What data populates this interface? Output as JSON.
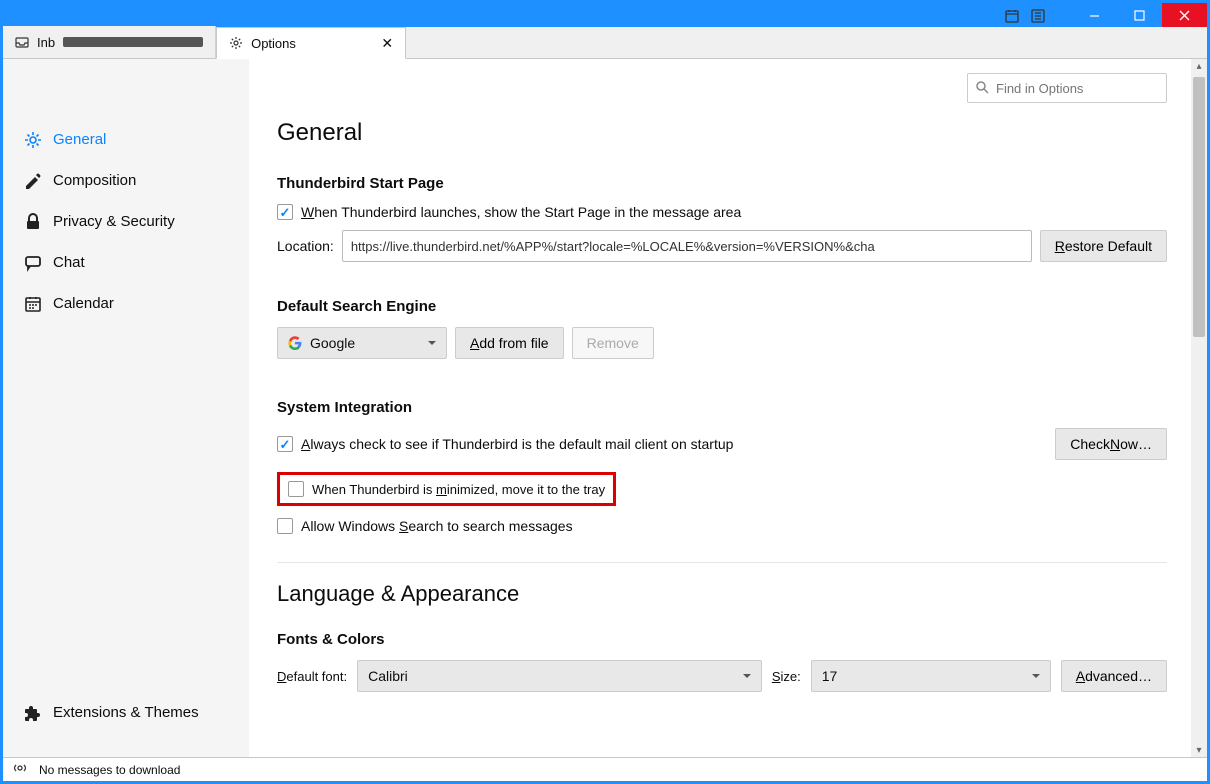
{
  "tabs": {
    "inbox": {
      "label": "Inb"
    },
    "options": {
      "label": "Options"
    }
  },
  "search": {
    "placeholder": "Find in Options"
  },
  "sidebar": {
    "general": "General",
    "composition": "Composition",
    "privacy": "Privacy & Security",
    "chat": "Chat",
    "calendar": "Calendar",
    "extensions": "Extensions & Themes"
  },
  "main": {
    "title": "General",
    "start": {
      "heading": "Thunderbird Start Page",
      "show_label": "When Thunderbird launches, show the Start Page in the message area",
      "location_label": "Location:",
      "location_value": "https://live.thunderbird.net/%APP%/start?locale=%LOCALE%&version=%VERSION%&cha",
      "restore": "Restore Default"
    },
    "search": {
      "heading": "Default Search Engine",
      "engine": "Google",
      "add": "Add from file",
      "remove": "Remove"
    },
    "system": {
      "heading": "System Integration",
      "always_check": "Always check to see if Thunderbird is the default mail client on startup",
      "check_now": "Check Now…",
      "minimize_tray": "When Thunderbird is minimized, move it to the tray",
      "windows_search": "Allow Windows Search to search messages"
    },
    "lang": {
      "heading": "Language & Appearance",
      "fonts_heading": "Fonts & Colors",
      "default_font_label": "Default font:",
      "font": "Calibri",
      "size_label": "Size:",
      "size": "17",
      "advanced": "Advanced…"
    }
  },
  "status": {
    "msg": "No messages to download"
  }
}
